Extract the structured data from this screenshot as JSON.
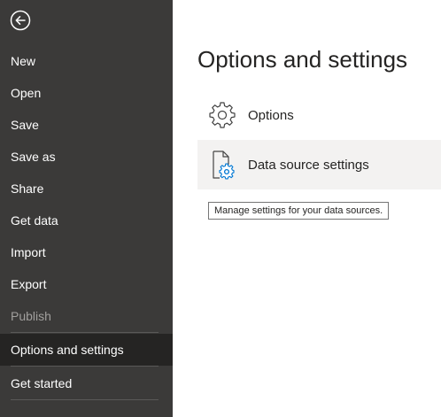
{
  "sidebar": {
    "back_icon": "back-arrow-icon",
    "items": [
      {
        "label": "New"
      },
      {
        "label": "Open"
      },
      {
        "label": "Save"
      },
      {
        "label": "Save as"
      },
      {
        "label": "Share"
      },
      {
        "label": "Get data"
      },
      {
        "label": "Import"
      },
      {
        "label": "Export"
      },
      {
        "label": "Publish",
        "state": "disabled"
      },
      {
        "label": "Options and settings",
        "state": "selected"
      },
      {
        "label": "Get started"
      }
    ]
  },
  "main": {
    "title": "Options and settings",
    "options": [
      {
        "label": "Options",
        "icon": "gear-icon"
      },
      {
        "label": "Data source settings",
        "icon": "data-source-settings-icon",
        "state": "hovered"
      }
    ],
    "tooltip": "Manage settings for your data sources."
  },
  "colors": {
    "sidebar_bg": "#3b3a39",
    "sidebar_selected_bg": "#252423",
    "sidebar_text": "#ffffff",
    "sidebar_disabled_text": "#a19f9d",
    "hover_bg": "#f3f2f1",
    "accent": "#0078d4"
  }
}
